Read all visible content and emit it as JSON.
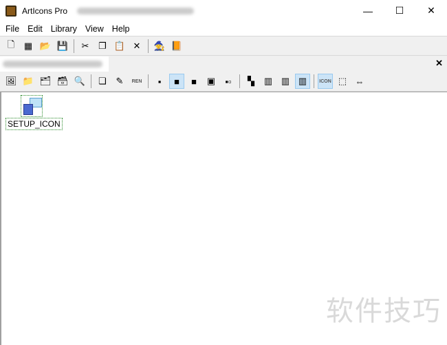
{
  "window": {
    "title": "ArtIcons Pro",
    "minimize": "—",
    "maximize": "☐",
    "close": "✕"
  },
  "menu": [
    "File",
    "Edit",
    "Library",
    "View",
    "Help"
  ],
  "toolbar1": [
    {
      "name": "new-icon",
      "glyph": "🗋"
    },
    {
      "name": "new-library-icon",
      "glyph": "▦"
    },
    {
      "name": "open-folder-icon",
      "glyph": "📂"
    },
    {
      "name": "save-icon",
      "glyph": "💾"
    },
    {
      "sep": true
    },
    {
      "name": "cut-icon",
      "glyph": "✂"
    },
    {
      "name": "copy-icon",
      "glyph": "❐"
    },
    {
      "name": "paste-icon",
      "glyph": "📋"
    },
    {
      "name": "delete-icon",
      "glyph": "✕"
    },
    {
      "sep": true
    },
    {
      "name": "wizard-icon",
      "glyph": "🧙"
    },
    {
      "name": "help-book-icon",
      "glyph": "📙"
    }
  ],
  "tab": {
    "close": "✕"
  },
  "toolbar2": [
    {
      "name": "new-image-icon",
      "glyph": "🖼"
    },
    {
      "name": "add-folder-icon",
      "glyph": "📁"
    },
    {
      "name": "add-folders-icon",
      "glyph": "🗂"
    },
    {
      "name": "add-files-icon",
      "glyph": "🗃"
    },
    {
      "name": "scan-icon",
      "glyph": "🔍"
    },
    {
      "sep": true
    },
    {
      "name": "duplicate-icon",
      "glyph": "❏"
    },
    {
      "name": "edit-pen-icon",
      "glyph": "✎"
    },
    {
      "name": "rename-icon",
      "glyph": "REN"
    },
    {
      "sep": true
    },
    {
      "name": "size-small-icon",
      "glyph": "▪"
    },
    {
      "name": "size-medium-icon",
      "glyph": "■",
      "on": true
    },
    {
      "name": "size-large-icon",
      "glyph": "■"
    },
    {
      "name": "size-xlarge-icon",
      "glyph": "▣"
    },
    {
      "name": "size-list-icon",
      "glyph": "▪▫"
    },
    {
      "sep": true
    },
    {
      "name": "color-mono-icon",
      "glyph": "▚"
    },
    {
      "name": "color-16-icon",
      "glyph": "▥"
    },
    {
      "name": "color-256-icon",
      "glyph": "▥"
    },
    {
      "name": "color-true-icon",
      "glyph": "▥",
      "on": true
    },
    {
      "sep": true
    },
    {
      "name": "icon-label-icon",
      "glyph": "ICON",
      "on": true
    },
    {
      "name": "fit-size-icon",
      "glyph": "⬚"
    },
    {
      "name": "resize-icon",
      "glyph": "⇔"
    }
  ],
  "items": [
    {
      "label": "SETUP_ICON"
    }
  ],
  "watermark": "软件技巧"
}
